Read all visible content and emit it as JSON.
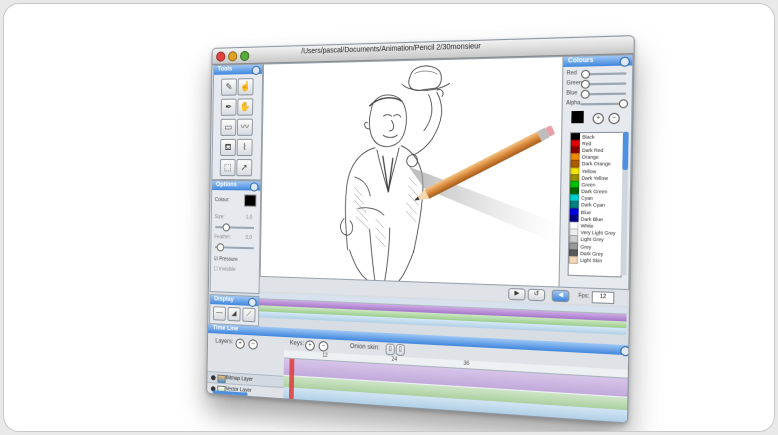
{
  "window": {
    "title": "/Users/pascal/Documents/Animation/Pencil 2/30monsieur"
  },
  "tools_panel": {
    "title": "Tools"
  },
  "options_panel": {
    "title": "Options",
    "colour_label": "Colour:",
    "size_label": "Size:",
    "size_value": "1,0",
    "feather_label": "Feather:",
    "feather_value": "0,0",
    "pressure_label": "Pressure",
    "invisible_label": "Invisible"
  },
  "display_panel": {
    "title": "Display"
  },
  "colours_panel": {
    "title": "Colours",
    "sliders": [
      "Red",
      "Green",
      "Blue",
      "Alpha"
    ],
    "list": [
      {
        "name": "Black",
        "color": "#000000"
      },
      {
        "name": "Red",
        "color": "#e00000"
      },
      {
        "name": "Dark Red",
        "color": "#8a0000"
      },
      {
        "name": "Orange",
        "color": "#f08a00"
      },
      {
        "name": "Dark Orange",
        "color": "#b05a00"
      },
      {
        "name": "Yellow",
        "color": "#f2e600"
      },
      {
        "name": "Dark Yellow",
        "color": "#9a9000"
      },
      {
        "name": "Green",
        "color": "#00c000"
      },
      {
        "name": "Dark Green",
        "color": "#006400"
      },
      {
        "name": "Cyan",
        "color": "#00d0d0"
      },
      {
        "name": "Dark Cyan",
        "color": "#008080"
      },
      {
        "name": "Blue",
        "color": "#0000e0"
      },
      {
        "name": "Dark Blue",
        "color": "#000080"
      },
      {
        "name": "White",
        "color": "#ffffff"
      },
      {
        "name": "Very Light Grey",
        "color": "#eeeeee"
      },
      {
        "name": "Light Grey",
        "color": "#cfcfcf"
      },
      {
        "name": "Grey",
        "color": "#9a9a9a"
      },
      {
        "name": "Dark Grey",
        "color": "#5a5a5a"
      },
      {
        "name": "Light Skin",
        "color": "#f7d9b8"
      }
    ]
  },
  "playback": {
    "fps_label": "Fps:",
    "fps_value": "12"
  },
  "timeline": {
    "title": "Time Line",
    "layers_label": "Layers:",
    "keys_label": "Keys:",
    "onion_label": "Onion skin:",
    "ruler_numbers": [
      "12",
      "24",
      "36"
    ],
    "layers": [
      {
        "name": "Bitmap Layer"
      },
      {
        "name": "Vector Layer"
      }
    ]
  }
}
